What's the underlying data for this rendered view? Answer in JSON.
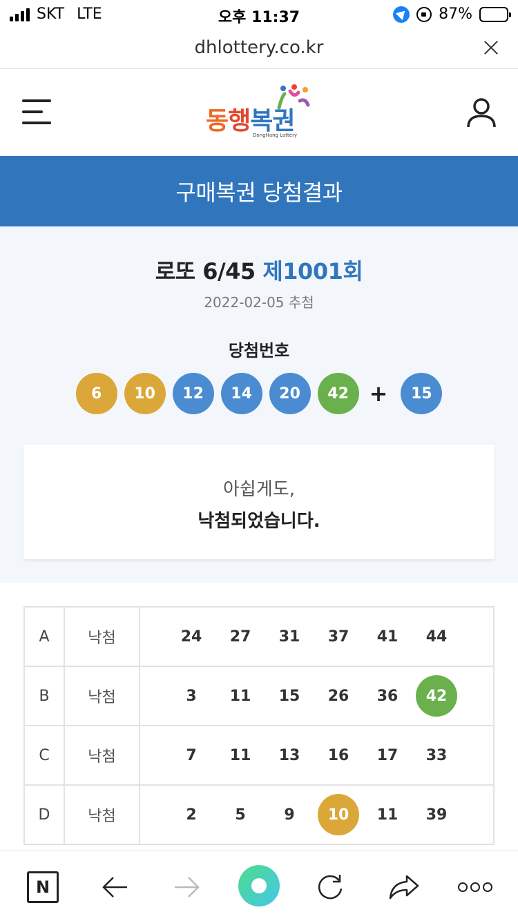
{
  "status_bar": {
    "carrier": "SKT",
    "network": "LTE",
    "time": "오후 11:37",
    "battery_text": "87%",
    "battery_level": 0.87
  },
  "browser": {
    "url": "dhlottery.co.kr"
  },
  "site": {
    "logo_chars": [
      "동",
      "행",
      "복",
      "권"
    ],
    "logo_sub": "DongHang Lottery",
    "page_title": "구매복권 당첨결과"
  },
  "result": {
    "game_name": "로또 6/45",
    "round": "제1001회",
    "draw_date": "2022-02-05 추첨",
    "winning_label": "당첨번호",
    "winning_numbers": [
      {
        "value": "6",
        "color": "#dca739"
      },
      {
        "value": "10",
        "color": "#dca739"
      },
      {
        "value": "12",
        "color": "#4a8bd2"
      },
      {
        "value": "14",
        "color": "#4a8bd2"
      },
      {
        "value": "20",
        "color": "#4a8bd2"
      },
      {
        "value": "42",
        "color": "#6ab04c"
      }
    ],
    "plus": "+",
    "bonus_number": {
      "value": "15",
      "color": "#4a8bd2"
    },
    "message_line1": "아쉽게도,",
    "message_line2": "낙첨되었습니다."
  },
  "tickets": [
    {
      "label": "A",
      "status": "낙첨",
      "numbers": [
        "24",
        "27",
        "31",
        "37",
        "41",
        "44"
      ],
      "hits": []
    },
    {
      "label": "B",
      "status": "낙첨",
      "numbers": [
        "3",
        "11",
        "15",
        "26",
        "36",
        "42"
      ],
      "hits": [
        {
          "index": 5,
          "color": "#6ab04c"
        }
      ]
    },
    {
      "label": "C",
      "status": "낙첨",
      "numbers": [
        "7",
        "11",
        "13",
        "16",
        "17",
        "33"
      ],
      "hits": []
    },
    {
      "label": "D",
      "status": "낙첨",
      "numbers": [
        "2",
        "5",
        "9",
        "10",
        "11",
        "39"
      ],
      "hits": [
        {
          "index": 3,
          "color": "#dca739"
        }
      ]
    }
  ],
  "toolbar": {
    "naver_label": "N"
  },
  "colors": {
    "brand_blue": "#3176bd",
    "ball_yellow": "#dca739",
    "ball_blue": "#4a8bd2",
    "ball_green": "#6ab04c"
  }
}
